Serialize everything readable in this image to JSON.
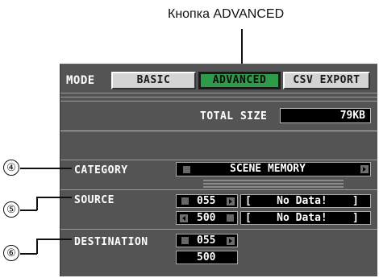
{
  "callout": {
    "title": "Кнопка ADVANCED"
  },
  "mode": {
    "label": "MODE",
    "tabs": [
      {
        "label": "BASIC",
        "active": false
      },
      {
        "label": "ADVANCED",
        "active": true
      },
      {
        "label": "CSV EXPORT",
        "active": false
      }
    ]
  },
  "total_size": {
    "label": "TOTAL SIZE",
    "value": "79KB"
  },
  "category": {
    "label": "CATEGORY",
    "value": "SCENE MEMORY"
  },
  "source": {
    "label": "SOURCE",
    "rows": [
      {
        "number": "055",
        "text": "[    No Data!    ]"
      },
      {
        "number": "500",
        "text": "[    No Data!    ]"
      }
    ]
  },
  "destination": {
    "label": "DESTINATION",
    "start": "055",
    "end": "500"
  },
  "callouts": [
    "④",
    "⑤",
    "⑥"
  ],
  "colors": {
    "panel": "#545454",
    "active_tab": "#2e9a4a",
    "box": "#000000"
  }
}
